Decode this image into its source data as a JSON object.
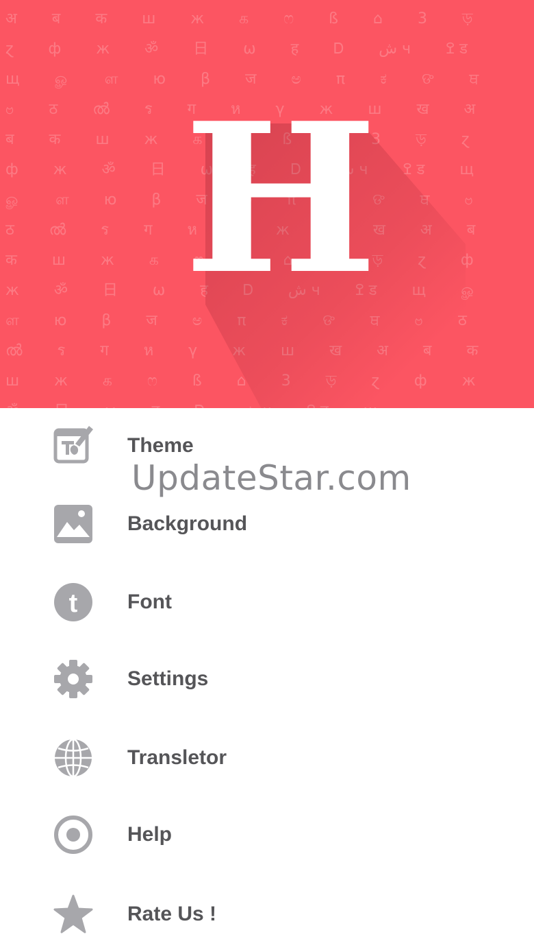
{
  "header": {
    "logo_letter": "H",
    "pattern_glyphs": "अ ब क ш ж க ෆ ß ⌂ 3 ড় ɀ ф ж ॐ 日 ω ह Ꭰ ش ч ߐ ड щ ௐ ள ю β ज ಅ π ಕ ଙ ਥ ဗ ठ ൽ ร ग ห γ ж ш ख अ ब क ш ж க ෆ ß ⌂ 3 ড় ɀ ф ж ॐ 日 ω ह Ꭰ ش ч ߐ ड щ ௐ ள ю β ज ಅ π ಕ ଙ ਥ ဗ ठ ൽ ร ग ห γ ж ш ख अ ब क ш ж க ෆ ß ⌂ 3 ড় ɀ ф ж ॐ 日 ω ह Ꭰ ش ч ߐ ड щ ௐ ள ю β ज ಅ π ಕ ଙ ਥ ဗ ठ ൽ ร ग ห γ ж ш ख अ ब क ш ж க ෆ ß ⌂ 3 ড় ɀ ф ж ॐ 日 ω ह Ꭰ ش ч ߐ ड щ ௐ ள ю β ज ಅ π ಕ ଙ ਥ ဗ ठ ൽ ร ग ห γ ж ш ख"
  },
  "menu": {
    "items": [
      {
        "label": "Theme",
        "icon": "theme-icon"
      },
      {
        "label": "Background",
        "icon": "image-icon"
      },
      {
        "label": "Font",
        "icon": "font-icon"
      },
      {
        "label": "Settings",
        "icon": "gear-icon"
      },
      {
        "label": "Transletor",
        "icon": "globe-icon"
      },
      {
        "label": "Help",
        "icon": "help-icon"
      },
      {
        "label": "Rate Us !",
        "icon": "star-icon"
      }
    ]
  },
  "watermark": "UpdateStar.com",
  "colors": {
    "header_bg": "#fc5562",
    "icon_gray": "#a7a7ab",
    "label_gray": "#555558"
  }
}
